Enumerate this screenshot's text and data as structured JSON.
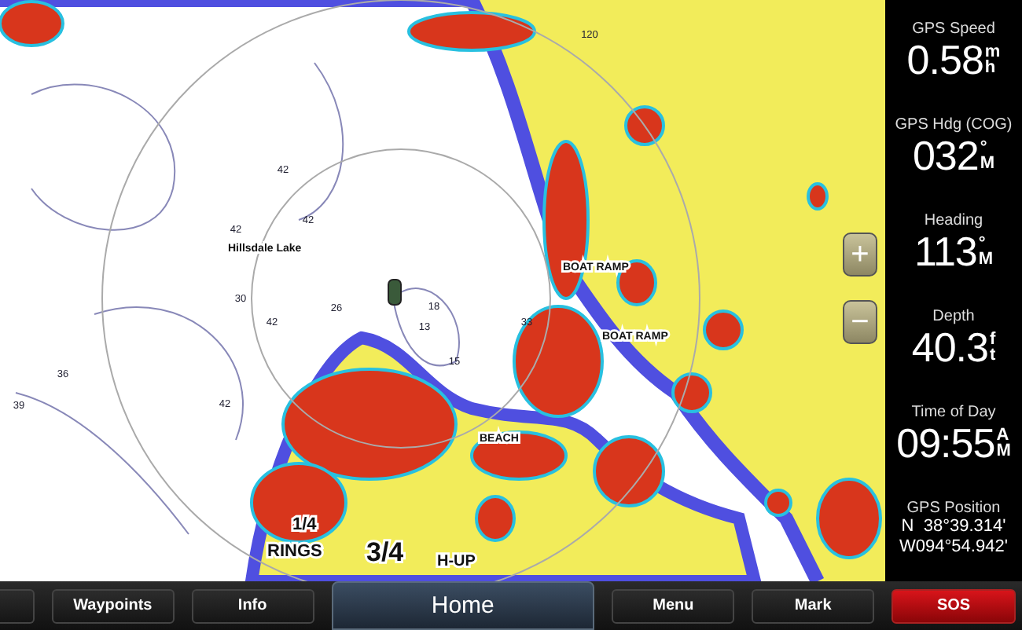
{
  "map": {
    "labels": [
      {
        "text": "Hillsdale Lake",
        "kind": "place"
      },
      {
        "text": "BOAT RAMP",
        "kind": "place"
      },
      {
        "text": "BOAT RAMP",
        "kind": "place"
      },
      {
        "text": "BEACH",
        "kind": "place"
      },
      {
        "text": "42",
        "kind": "depth"
      },
      {
        "text": "42",
        "kind": "depth"
      },
      {
        "text": "42",
        "kind": "depth"
      },
      {
        "text": "30",
        "kind": "depth"
      },
      {
        "text": "42",
        "kind": "depth"
      },
      {
        "text": "26",
        "kind": "depth"
      },
      {
        "text": "13",
        "kind": "depth"
      },
      {
        "text": "18",
        "kind": "depth"
      },
      {
        "text": "15",
        "kind": "depth"
      },
      {
        "text": "33",
        "kind": "depth"
      },
      {
        "text": "42",
        "kind": "depth"
      },
      {
        "text": "36",
        "kind": "depth"
      },
      {
        "text": "39",
        "kind": "depth"
      },
      {
        "text": "120",
        "kind": "depth"
      }
    ],
    "range": {
      "near": "1/4",
      "rings": "RINGS",
      "far": "3/4",
      "orientation": "H-UP"
    },
    "zoom_buttons": [
      "+",
      "−"
    ]
  },
  "panel": [
    {
      "label": "GPS Speed",
      "value": "0.58",
      "unit_top": "m",
      "unit_bottom": "h"
    },
    {
      "label": "GPS Hdg (COG)",
      "value": "032",
      "unit_top": "°",
      "unit_bottom": "M"
    },
    {
      "label": "Heading",
      "value": "113",
      "unit_top": "°",
      "unit_bottom": "M"
    },
    {
      "label": "Depth",
      "value": "40.3",
      "unit_top": "f",
      "unit_bottom": "t"
    },
    {
      "label": "Time of Day",
      "value": "09:55",
      "unit_top": "A",
      "unit_bottom": "M"
    },
    {
      "label": "GPS Position",
      "lines": [
        "N  38°39.314'",
        "W094°54.942'"
      ]
    }
  ],
  "softkeys": [
    {
      "kind": "plain"
    },
    {
      "label": "Waypoints",
      "kind": "plain"
    },
    {
      "label": "Info",
      "kind": "plain"
    },
    {
      "label": "Home",
      "kind": "home"
    },
    {
      "label": "Menu",
      "kind": "plain"
    },
    {
      "label": "Mark",
      "kind": "plain"
    },
    {
      "label": "SOS",
      "kind": "alert"
    }
  ]
}
